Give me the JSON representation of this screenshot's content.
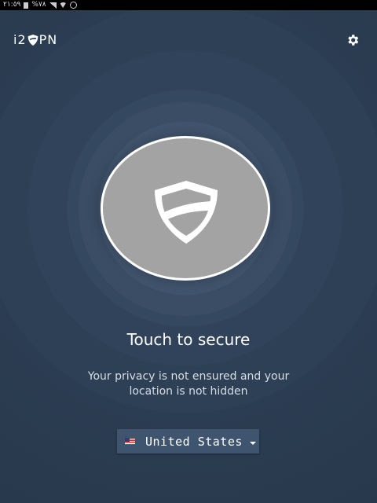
{
  "status_bar": {
    "time": "٢١:٥٩",
    "battery": "%٧٨",
    "icons": [
      "sim-icon",
      "signal-icon",
      "wifi-icon",
      "alarm-icon"
    ]
  },
  "header": {
    "logo_left": "i2",
    "logo_right": "PN",
    "logo_icon": "shield-logo-icon",
    "settings_icon": "gear-icon"
  },
  "main": {
    "connect_icon": "shield-icon",
    "headline": "Touch to secure",
    "status_message": "Your privacy is not ensured and your location is not hidden"
  },
  "location_selector": {
    "selected_country": "United States",
    "flag_icon": "us-flag-icon",
    "dropdown_icon": "chevron-down-icon"
  },
  "colors": {
    "background": "#2d4056",
    "button_fill": "#a3a3a3",
    "button_border": "#ffffff",
    "selector_bg": "#3f556f",
    "text": "#ffffff"
  }
}
